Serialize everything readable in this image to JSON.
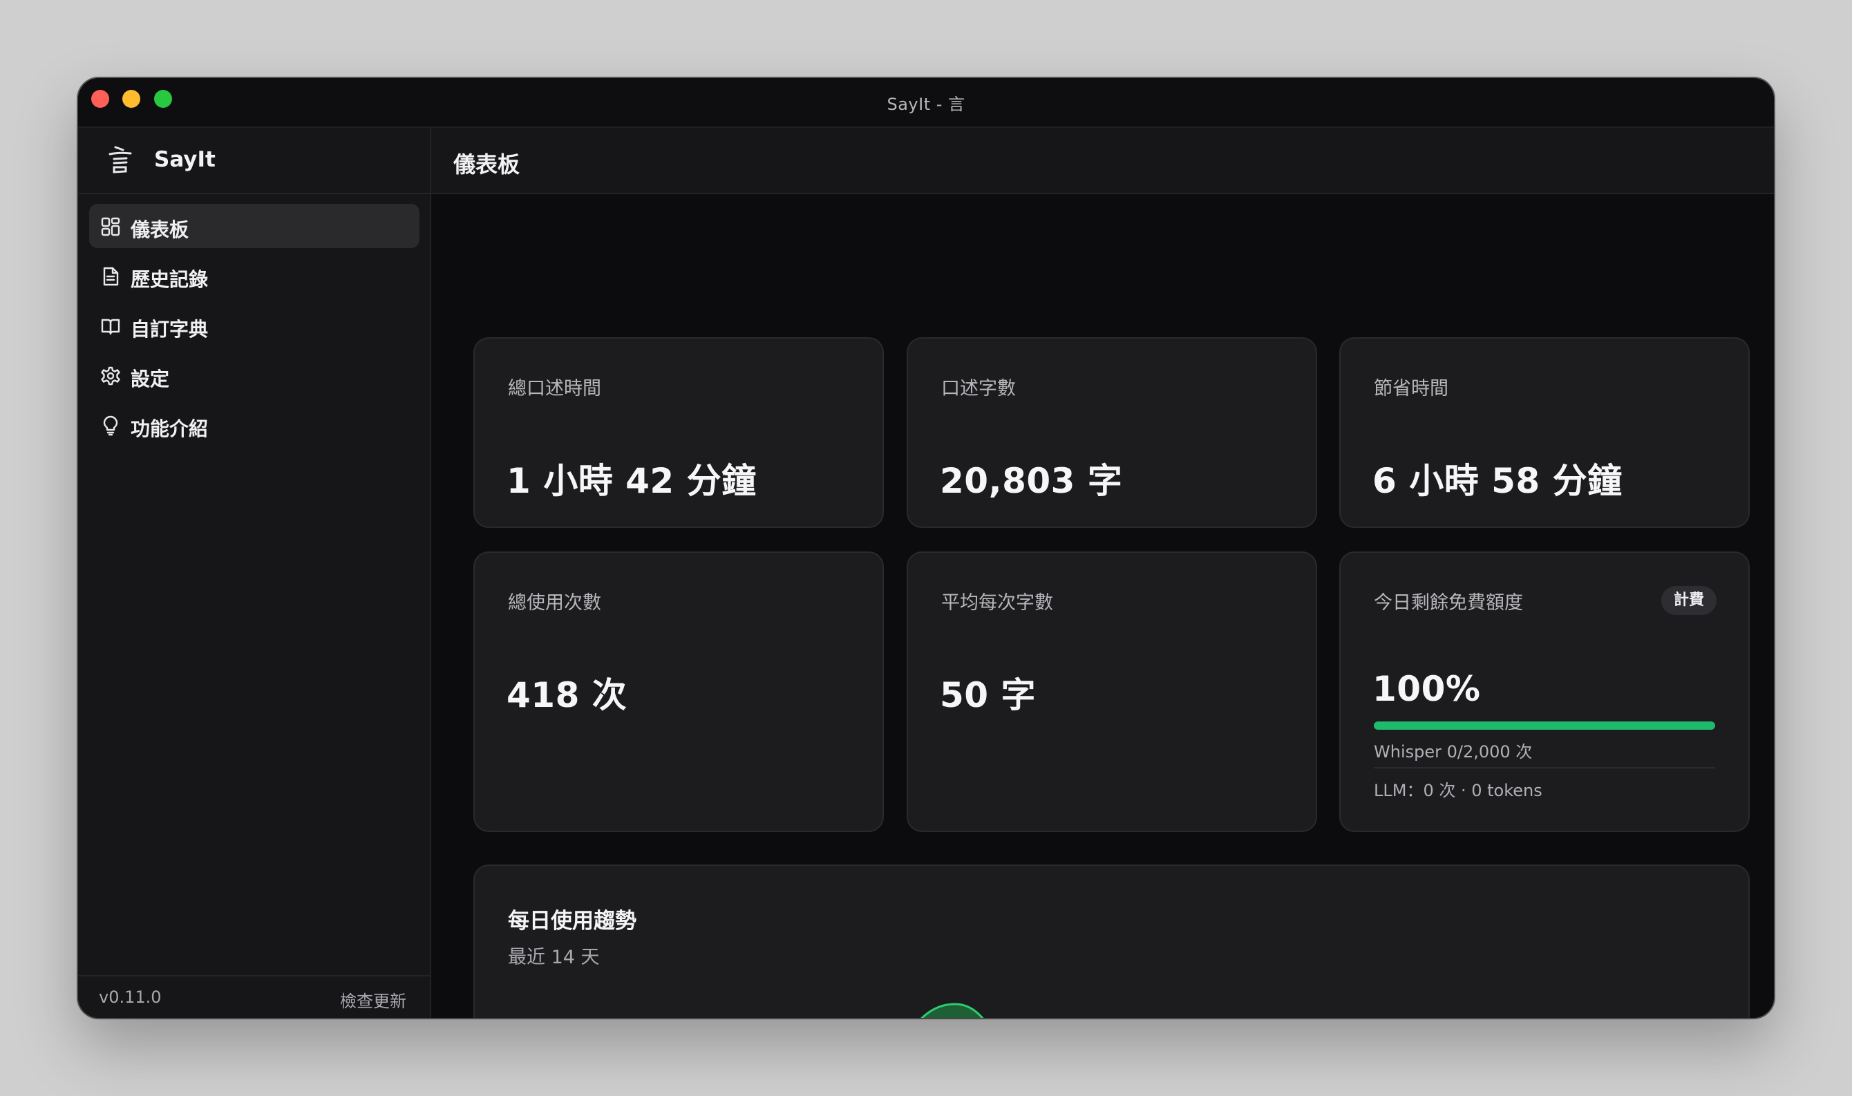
{
  "window": {
    "title": "SayIt - 言"
  },
  "sidebar": {
    "brand": "SayIt",
    "items": [
      {
        "label": "儀表板",
        "icon": "dashboard-icon",
        "active": true
      },
      {
        "label": "歷史記錄",
        "icon": "document-icon",
        "active": false
      },
      {
        "label": "自訂字典",
        "icon": "book-icon",
        "active": false
      },
      {
        "label": "設定",
        "icon": "gear-icon",
        "active": false
      },
      {
        "label": "功能介紹",
        "icon": "lightbulb-icon",
        "active": false
      }
    ],
    "version": "v0.11.0",
    "update_label": "檢查更新"
  },
  "header": {
    "title": "儀表板"
  },
  "stats": [
    {
      "label": "總口述時間",
      "value": "1 小時 42 分鐘"
    },
    {
      "label": "口述字數",
      "value": "20,803 字"
    },
    {
      "label": "節省時間",
      "value": "6 小時 58 分鐘"
    },
    {
      "label": "總使用次數",
      "value": "418 次"
    },
    {
      "label": "平均每次字數",
      "value": "50 字"
    }
  ],
  "quota": {
    "label": "今日剩餘免費額度",
    "badge": "計費",
    "value": "100%",
    "percent": 100,
    "whisper": "Whisper 0/2,000 次",
    "llm": "LLM：0 次 · 0 tokens"
  },
  "trend": {
    "title": "每日使用趨勢",
    "subtitle": "最近 14 天"
  },
  "colors": {
    "accent": "#1fba6b",
    "chart_fill": "#1f6b3a",
    "chart_line": "#2ecc71"
  }
}
